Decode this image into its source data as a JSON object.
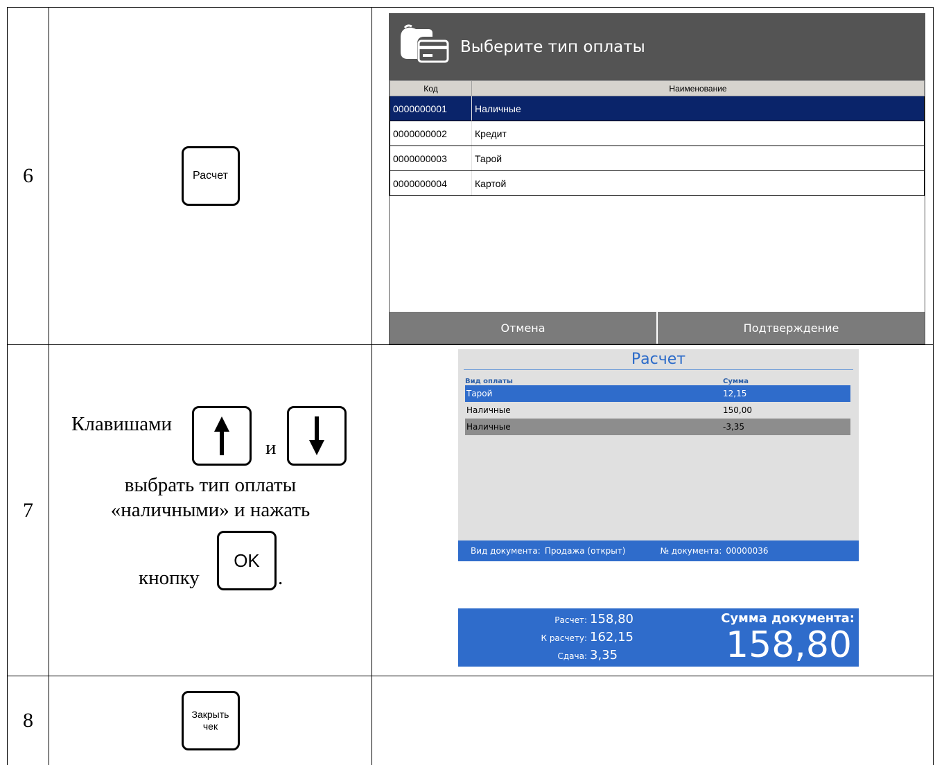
{
  "steps": [
    {
      "number": "6",
      "key_label": "Расчет"
    },
    {
      "number": "7",
      "text_before_keys": "Клавишами",
      "text_between_keys": "и",
      "line2": "выбрать тип оплаты",
      "line3": "«наличными» и нажать",
      "line4_prefix": "кнопку",
      "line4_suffix": ".",
      "ok_label": "OK",
      "arrow_up_icon": "arrow-up-icon",
      "arrow_down_icon": "arrow-down-icon"
    },
    {
      "number": "8",
      "key_label": "Закрыть чек"
    }
  ],
  "payment_dialog": {
    "title": "Выберите тип оплаты",
    "icon": "wallet-card-icon",
    "columns": [
      "Код",
      "Наименование"
    ],
    "rows": [
      {
        "code": "0000000001",
        "name": "Наличные",
        "selected": true
      },
      {
        "code": "0000000002",
        "name": "Кредит"
      },
      {
        "code": "0000000003",
        "name": "Тарой"
      },
      {
        "code": "0000000004",
        "name": "Картой"
      }
    ],
    "cancel_label": "Отмена",
    "confirm_label": "Подтверждение",
    "header_color": "#545454",
    "selection_color": "#0a246a"
  },
  "settlement": {
    "title": "Расчет",
    "col_type": "Вид оплаты",
    "col_sum": "Сумма",
    "rows": [
      {
        "type": "Тарой",
        "sum": "12,15",
        "state": "selected"
      },
      {
        "type": "Наличные",
        "sum": "150,00",
        "state": "normal"
      },
      {
        "type": "Наличные",
        "sum": "-3,35",
        "state": "gray"
      }
    ],
    "doc_type_label": "Вид документа:",
    "doc_type_value": "Продажа (открыт)",
    "doc_num_label": "№ документа:",
    "doc_num_value": "00000036",
    "calc_label": "Расчет:",
    "calc_value": "158,80",
    "to_pay_label": "К расчету:",
    "to_pay_value": "162,15",
    "change_label": "Сдача:",
    "change_value": "3,35",
    "doc_sum_label": "Сумма документа:",
    "doc_sum_value": "158,80",
    "accent_color": "#2f6ccb"
  }
}
